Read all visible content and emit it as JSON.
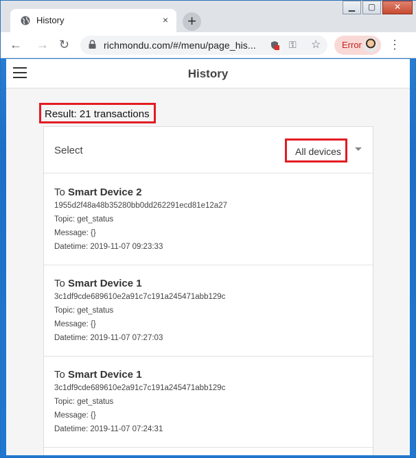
{
  "browser": {
    "tab_title": "History",
    "tab_close": "×",
    "new_tab": "+",
    "url": "richmondu.com/#/menu/page_his...",
    "error_label": "Error",
    "window_buttons": {
      "minimize": "▁",
      "maximize": "▢",
      "close": "✕"
    }
  },
  "app": {
    "title": "History"
  },
  "result": {
    "label": "Result: 21 transactions"
  },
  "filter": {
    "label": "Select",
    "selected": "All devices"
  },
  "transactions": [
    {
      "prefix": "To ",
      "device": "Smart Device 2",
      "id": "1955d2f48a48b35280bb0dd262291ecd81e12a27",
      "topic": "Topic: get_status",
      "message": "Message: {}",
      "datetime": "Datetime: 2019-11-07 09:23:33"
    },
    {
      "prefix": "To ",
      "device": "Smart Device 1",
      "id": "3c1df9cde689610e2a91c7c191a245471abb129c",
      "topic": "Topic: get_status",
      "message": "Message: {}",
      "datetime": "Datetime: 2019-11-07 07:27:03"
    },
    {
      "prefix": "To ",
      "device": "Smart Device 1",
      "id": "3c1df9cde689610e2a91c7c191a245471abb129c",
      "topic": "Topic: get_status",
      "message": "Message: {}",
      "datetime": "Datetime: 2019-11-07 07:24:31"
    }
  ],
  "colors": {
    "highlight": "#e31b23",
    "error_bg": "#f9d9d6",
    "error_text": "#c5221f"
  }
}
